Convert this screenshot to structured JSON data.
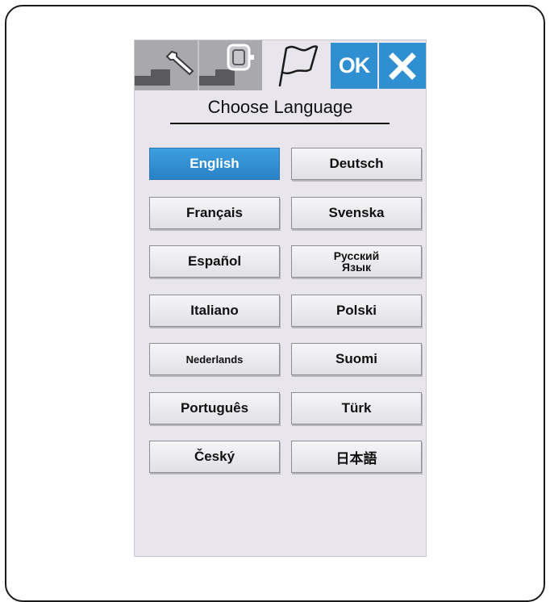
{
  "toolbar": {
    "tabs": [
      {
        "name": "settings",
        "icon": "wrench-icon"
      },
      {
        "name": "embroidery",
        "icon": "embroidery-hoop-icon"
      },
      {
        "name": "language",
        "icon": "flag-icon"
      }
    ],
    "ok_label": "OK",
    "close_icon": "close-icon"
  },
  "title": "Choose Language",
  "languages": [
    {
      "label": "English",
      "selected": true
    },
    {
      "label": "Deutsch",
      "selected": false
    },
    {
      "label": "Français",
      "selected": false
    },
    {
      "label": "Svenska",
      "selected": false
    },
    {
      "label": "Español",
      "selected": false
    },
    {
      "label": "Русский\nЯзык",
      "selected": false
    },
    {
      "label": "Italiano",
      "selected": false
    },
    {
      "label": "Polski",
      "selected": false
    },
    {
      "label": "Nederlands",
      "selected": false
    },
    {
      "label": "Suomi",
      "selected": false
    },
    {
      "label": "Português",
      "selected": false
    },
    {
      "label": "Türk",
      "selected": false
    },
    {
      "label": "Český",
      "selected": false
    },
    {
      "label": "日本語",
      "selected": false
    }
  ],
  "colors": {
    "accent": "#2f8fd0",
    "screen_bg": "#e8e6ec",
    "inactive_tab": "#a9a9ad"
  }
}
